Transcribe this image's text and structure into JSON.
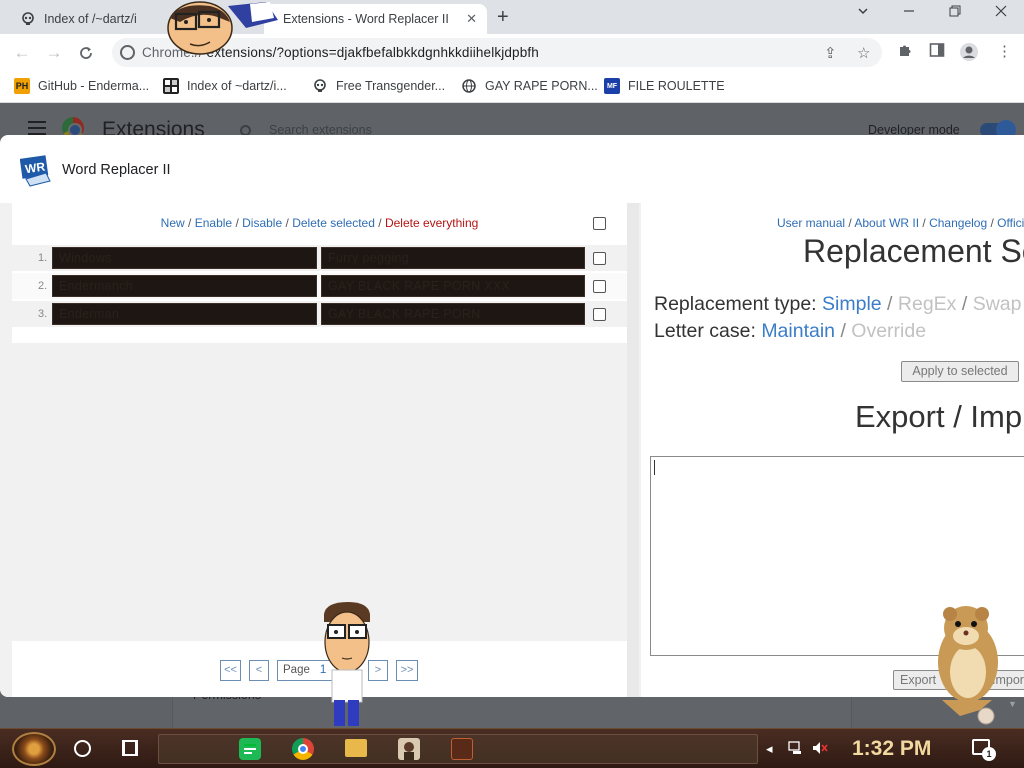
{
  "browser": {
    "tabs": [
      {
        "title": "Index of /~dartz/i",
        "active": false
      },
      {
        "title": "Extensions - Word Replacer II",
        "active": true
      }
    ],
    "new_tab_glyph": "+",
    "url_scheme": "Chrome://",
    "url_rest": "extensions/?options=djakfbefalbkkdgnhkkdiihelkjdpbfh",
    "bookmarks": [
      {
        "label": "GitHub - Enderma...",
        "icon": "PH"
      },
      {
        "label": "Index of ~dartz/i...",
        "icon": "grid"
      },
      {
        "label": "Free Transgender...",
        "icon": "skull"
      },
      {
        "label": "GAY RAPE PORN...",
        "icon": "globe"
      },
      {
        "label": "FILE ROULETTE",
        "icon": "MF"
      }
    ]
  },
  "background_page": {
    "title": "Extensions",
    "search_placeholder": "Search extensions",
    "developer_mode_label": "Developer mode",
    "developer_mode_on": true,
    "card_label": "Permissions"
  },
  "dialog": {
    "title": "Word Replacer II",
    "logo_text": "WR",
    "actions": {
      "new": "New",
      "enable": "Enable",
      "disable": "Disable",
      "delete_selected": "Delete selected",
      "delete_everything": "Delete everything",
      "sep": "/"
    },
    "rules": [
      {
        "num": "1.",
        "find": "Windows",
        "replace": "Furry pegging"
      },
      {
        "num": "2.",
        "find": "Endermanch",
        "replace": "GAY BLACK RAPE PORN XXX"
      },
      {
        "num": "3.",
        "find": "Enderman",
        "replace": "GAY BLACK RAPE PORN"
      }
    ],
    "pager": {
      "first": "<<",
      "prev": "<",
      "page_label": "Page",
      "page_value": "1",
      "next": ">",
      "last": ">>"
    },
    "right": {
      "links": [
        "User manual",
        "About WR II",
        "Changelog",
        "Offici"
      ],
      "section_title": "Replacement Se",
      "replacement_type_label": "Replacement type:",
      "replacement_types": [
        "Simple",
        "RegEx",
        "Swap"
      ],
      "replacement_type_selected": "Simple",
      "letter_case_label": "Letter case:",
      "letter_cases": [
        "Maintain",
        "Override"
      ],
      "letter_case_selected": "Maintain",
      "apply_button": "Apply to selected",
      "export_import_title": "Export / Imp",
      "export_button": "Export",
      "import_button": "Import"
    }
  },
  "taskbar": {
    "clock": "1:32 PM",
    "notification_count": "1"
  }
}
